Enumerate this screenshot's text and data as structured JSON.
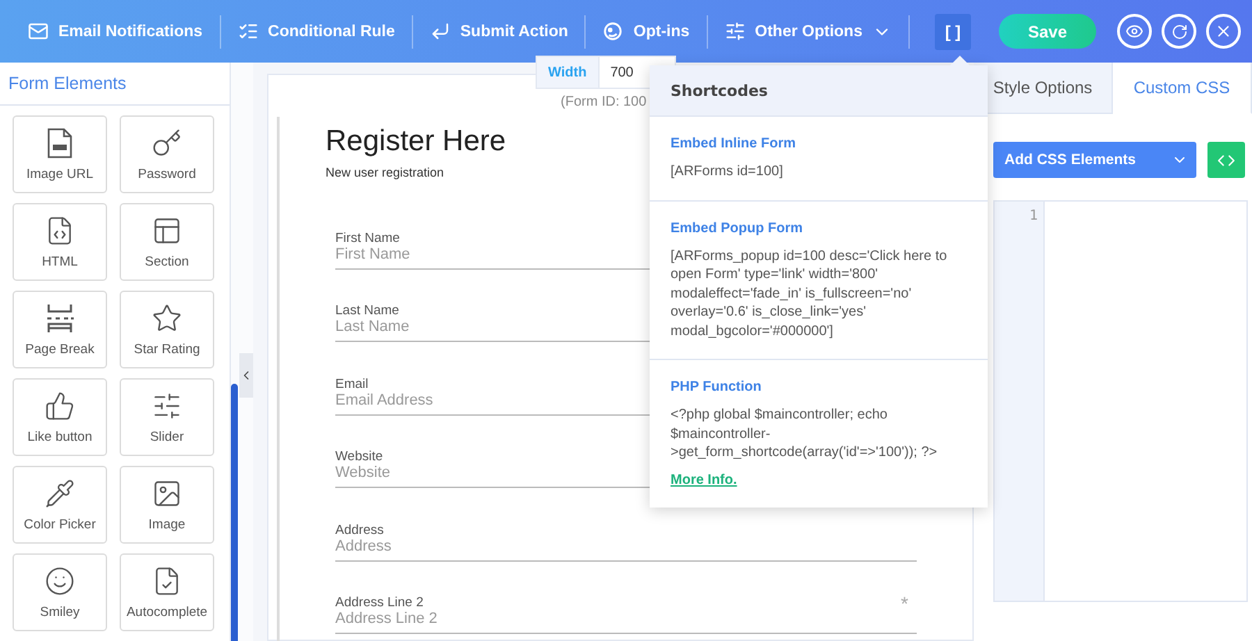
{
  "toolbar": {
    "items": [
      {
        "label": "Email Notifications",
        "dropdown": false
      },
      {
        "label": "Conditional Rule",
        "dropdown": false
      },
      {
        "label": "Submit Action",
        "dropdown": false
      },
      {
        "label": "Opt-ins",
        "dropdown": false
      },
      {
        "label": "Other Options",
        "dropdown": true
      }
    ],
    "shortcode_button": {
      "label": "[ ]",
      "selected": true
    },
    "save": "Save"
  },
  "sidebar": {
    "title": "Form Elements",
    "items": [
      {
        "label": "Image URL"
      },
      {
        "label": "Password"
      },
      {
        "label": "HTML"
      },
      {
        "label": "Section"
      },
      {
        "label": "Page Break"
      },
      {
        "label": "Star Rating"
      },
      {
        "label": "Like button"
      },
      {
        "label": "Slider"
      },
      {
        "label": "Color Picker"
      },
      {
        "label": "Image"
      },
      {
        "label": "Smiley"
      },
      {
        "label": "Autocomplete"
      }
    ]
  },
  "canvas": {
    "required_mark": "*",
    "width_label": "Width",
    "width_value": "700",
    "form_id": "(Form ID: 100",
    "title": "Register Here",
    "subtitle": "New user registration",
    "fields": [
      {
        "label": "First Name",
        "placeholder": "First Name",
        "required": false
      },
      {
        "label": "Last Name",
        "placeholder": "Last Name",
        "required": false
      },
      {
        "label": "Email",
        "placeholder": "Email Address",
        "required": false
      },
      {
        "label": "Website",
        "placeholder": "Website",
        "required": false
      },
      {
        "label": "Address",
        "placeholder": "Address",
        "required": false
      },
      {
        "label": "Address Line 2",
        "placeholder": "Address Line 2",
        "required": true
      }
    ]
  },
  "shortcodes": {
    "title": "Shortcodes",
    "sections": [
      {
        "heading": "Embed Inline Form",
        "code": "[ARForms id=100]"
      },
      {
        "heading": "Embed Popup Form",
        "code": "[ARForms_popup id=100 desc='Click here to open Form' type='link' width='800' modaleffect='fade_in' is_fullscreen='no' overlay='0.6' is_close_link='yes' modal_bgcolor='#000000']"
      },
      {
        "heading": "PHP Function",
        "code": "<?php global $maincontroller; echo $maincontroller->get_form_shortcode(array('id'=>'100')); ?>",
        "link": "More Info."
      }
    ]
  },
  "right_panel": {
    "tabs": [
      {
        "label": "Style Options",
        "selected": false
      },
      {
        "label": "Custom CSS",
        "selected": true
      }
    ],
    "add_button": "Add CSS Elements",
    "line_number": "1"
  }
}
